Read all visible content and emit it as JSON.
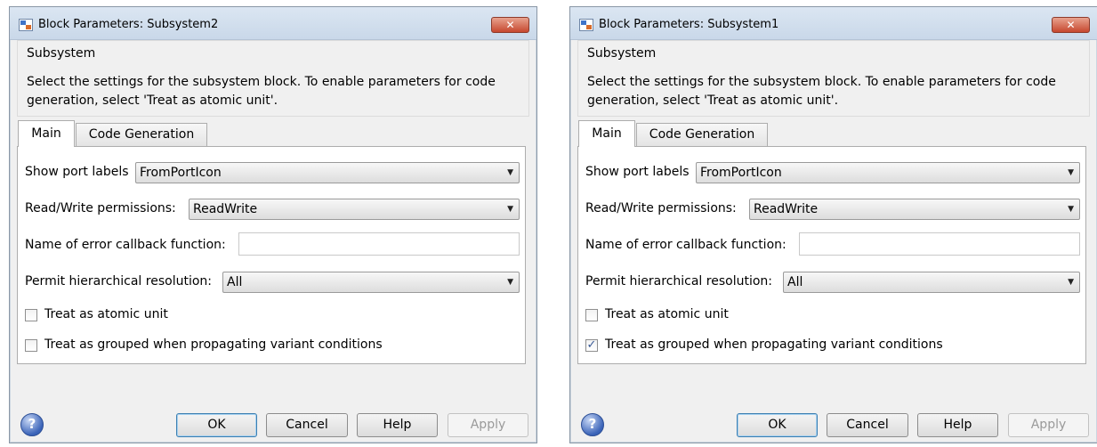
{
  "dialogs": [
    {
      "title": "Block Parameters: Subsystem2",
      "close_label": "✕",
      "group_title": "Subsystem",
      "description": "Select the settings for the subsystem block. To enable parameters for code generation, select 'Treat as atomic unit'.",
      "tabs": [
        {
          "label": "Main"
        },
        {
          "label": "Code Generation"
        }
      ],
      "params": {
        "show_port_labels": {
          "label": "Show port labels",
          "value": "FromPortIcon"
        },
        "read_write": {
          "label": "Read/Write permissions:",
          "value": "ReadWrite"
        },
        "error_callback": {
          "label": "Name of error callback function:",
          "value": ""
        },
        "hier_resolution": {
          "label": "Permit hierarchical resolution:",
          "value": "All"
        },
        "atomic": {
          "label": "Treat as atomic unit",
          "checked": false,
          "mark": ""
        },
        "grouped": {
          "label": "Treat as grouped when propagating variant conditions",
          "checked": false,
          "mark": ""
        }
      },
      "buttons": {
        "help_icon": "?",
        "ok": "OK",
        "cancel": "Cancel",
        "help": "Help",
        "apply": "Apply"
      }
    },
    {
      "title": "Block Parameters: Subsystem1",
      "close_label": "✕",
      "group_title": "Subsystem",
      "description": "Select the settings for the subsystem block. To enable parameters for code generation, select 'Treat as atomic unit'.",
      "tabs": [
        {
          "label": "Main"
        },
        {
          "label": "Code Generation"
        }
      ],
      "params": {
        "show_port_labels": {
          "label": "Show port labels",
          "value": "FromPortIcon"
        },
        "read_write": {
          "label": "Read/Write permissions:",
          "value": "ReadWrite"
        },
        "error_callback": {
          "label": "Name of error callback function:",
          "value": ""
        },
        "hier_resolution": {
          "label": "Permit hierarchical resolution:",
          "value": "All"
        },
        "atomic": {
          "label": "Treat as atomic unit",
          "checked": false,
          "mark": ""
        },
        "grouped": {
          "label": "Treat as grouped when propagating variant conditions",
          "checked": true,
          "mark": "✓"
        }
      },
      "buttons": {
        "help_icon": "?",
        "ok": "OK",
        "cancel": "Cancel",
        "help": "Help",
        "apply": "Apply"
      }
    }
  ],
  "icons": {
    "dropdown_arrow": "▼",
    "title_icon": "block-parameters-icon",
    "help_icon": "question-icon"
  }
}
